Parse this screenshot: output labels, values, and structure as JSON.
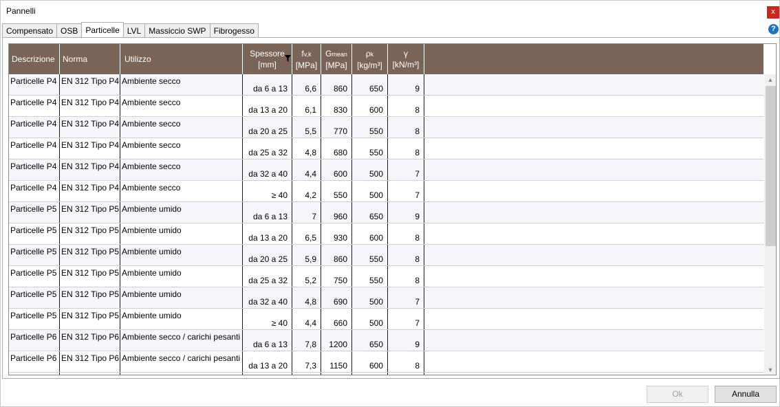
{
  "window": {
    "title": "Pannelli",
    "close_label": "x",
    "help_label": "?"
  },
  "tabs": [
    {
      "label": "Compensato",
      "active": false
    },
    {
      "label": "OSB",
      "active": false
    },
    {
      "label": "Particelle",
      "active": true
    },
    {
      "label": "LVL",
      "active": false
    },
    {
      "label": "Massiccio SWP",
      "active": false
    },
    {
      "label": "Fibrogesso",
      "active": false
    }
  ],
  "table": {
    "header_color": "#7a6458",
    "columns": {
      "descrizione": "Descrizione",
      "norma": "Norma",
      "utilizzo": "Utilizzo",
      "spessore": "Spessore",
      "spessore_unit": "[mm]",
      "fvk": "f",
      "fvk_sub": "v,k",
      "fvk_unit": "[MPa]",
      "gmean": "G",
      "gmean_sub": "mean",
      "gmean_unit": "[MPa]",
      "rhok": "ρ",
      "rhok_sub": "k",
      "rhok_unit": "[kg/m³]",
      "gamma": "γ",
      "gamma_unit": "[kN/m³]"
    },
    "rows": [
      {
        "descrizione": "Particelle P4",
        "norma": "EN 312 Tipo P4",
        "utilizzo": "Ambiente secco",
        "spessore": "da 6 a 13",
        "fvk": "6,6",
        "gmean": "860",
        "rhok": "650",
        "gamma": "9"
      },
      {
        "descrizione": "Particelle P4",
        "norma": "EN 312 Tipo P4",
        "utilizzo": "Ambiente secco",
        "spessore": "da 13 a 20",
        "fvk": "6,1",
        "gmean": "830",
        "rhok": "600",
        "gamma": "8"
      },
      {
        "descrizione": "Particelle P4",
        "norma": "EN 312 Tipo P4",
        "utilizzo": "Ambiente secco",
        "spessore": "da 20 a 25",
        "fvk": "5,5",
        "gmean": "770",
        "rhok": "550",
        "gamma": "8"
      },
      {
        "descrizione": "Particelle P4",
        "norma": "EN 312 Tipo P4",
        "utilizzo": "Ambiente secco",
        "spessore": "da 25 a 32",
        "fvk": "4,8",
        "gmean": "680",
        "rhok": "550",
        "gamma": "8"
      },
      {
        "descrizione": "Particelle P4",
        "norma": "EN 312 Tipo P4",
        "utilizzo": "Ambiente secco",
        "spessore": "da 32 a 40",
        "fvk": "4,4",
        "gmean": "600",
        "rhok": "500",
        "gamma": "7"
      },
      {
        "descrizione": "Particelle P4",
        "norma": "EN 312 Tipo P4",
        "utilizzo": "Ambiente secco",
        "spessore": "≥ 40",
        "fvk": "4,2",
        "gmean": "550",
        "rhok": "500",
        "gamma": "7"
      },
      {
        "descrizione": "Particelle P5",
        "norma": "EN 312 Tipo P5",
        "utilizzo": "Ambiente umido",
        "spessore": "da 6 a 13",
        "fvk": "7",
        "gmean": "960",
        "rhok": "650",
        "gamma": "9"
      },
      {
        "descrizione": "Particelle P5",
        "norma": "EN 312 Tipo P5",
        "utilizzo": "Ambiente umido",
        "spessore": "da 13 a 20",
        "fvk": "6,5",
        "gmean": "930",
        "rhok": "600",
        "gamma": "8"
      },
      {
        "descrizione": "Particelle P5",
        "norma": "EN 312 Tipo P5",
        "utilizzo": "Ambiente umido",
        "spessore": "da 20 a 25",
        "fvk": "5,9",
        "gmean": "860",
        "rhok": "550",
        "gamma": "8"
      },
      {
        "descrizione": "Particelle P5",
        "norma": "EN 312 Tipo P5",
        "utilizzo": "Ambiente umido",
        "spessore": "da 25 a 32",
        "fvk": "5,2",
        "gmean": "750",
        "rhok": "550",
        "gamma": "8"
      },
      {
        "descrizione": "Particelle P5",
        "norma": "EN 312 Tipo P5",
        "utilizzo": "Ambiente umido",
        "spessore": "da 32 a 40",
        "fvk": "4,8",
        "gmean": "690",
        "rhok": "500",
        "gamma": "7"
      },
      {
        "descrizione": "Particelle P5",
        "norma": "EN 312 Tipo P5",
        "utilizzo": "Ambiente umido",
        "spessore": "≥ 40",
        "fvk": "4,4",
        "gmean": "660",
        "rhok": "500",
        "gamma": "7"
      },
      {
        "descrizione": "Particelle P6",
        "norma": "EN 312 Tipo P6",
        "utilizzo": "Ambiente secco / carichi pesanti",
        "spessore": "da 6 a 13",
        "fvk": "7,8",
        "gmean": "1200",
        "rhok": "650",
        "gamma": "9"
      },
      {
        "descrizione": "Particelle P6",
        "norma": "EN 312 Tipo P6",
        "utilizzo": "Ambiente secco / carichi pesanti",
        "spessore": "da 13 a 20",
        "fvk": "7,3",
        "gmean": "1150",
        "rhok": "600",
        "gamma": "8"
      },
      {
        "descrizione": "",
        "norma": "",
        "utilizzo": "",
        "spessore": "",
        "fvk": "",
        "gmean": "",
        "rhok": "",
        "gamma": ""
      }
    ]
  },
  "buttons": {
    "ok": "Ok",
    "cancel": "Annulla"
  }
}
